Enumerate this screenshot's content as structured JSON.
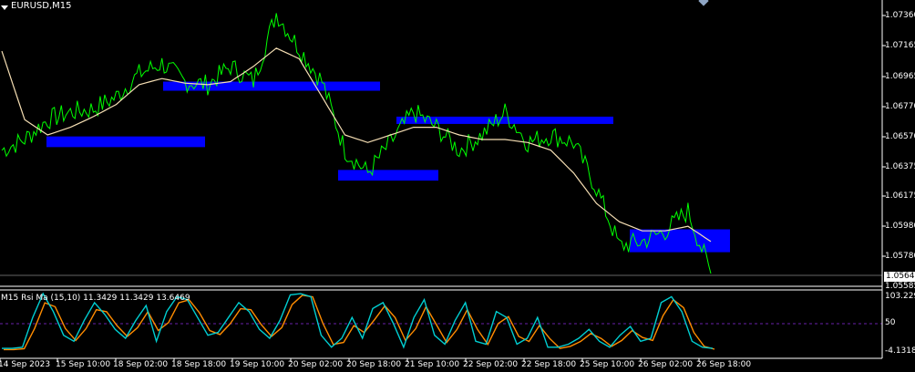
{
  "chart_title": "EURUSD,M15",
  "price_axis": {
    "ticks": [
      "1.07360",
      "1.07165",
      "1.06965",
      "1.06770",
      "1.06570",
      "1.06375",
      "1.06175",
      "1.05980",
      "1.05780",
      "1.05585"
    ],
    "current_price": "1.05647"
  },
  "rsi_panel": {
    "label": "M15  Rsi Ma (15,10) 11.3429 11.3429 13.6469",
    "ticks": [
      "103.229",
      "50",
      "-4.1318"
    ]
  },
  "time_axis": {
    "labels": [
      "14 Sep 2023",
      "15 Sep 10:00",
      "18 Sep 02:00",
      "18 Sep 18:00",
      "19 Sep 10:00",
      "20 Sep 02:00",
      "20 Sep 18:00",
      "21 Sep 10:00",
      "22 Sep 02:00",
      "22 Sep 18:00",
      "25 Sep 10:00",
      "26 Sep 02:00",
      "26 Sep 18:00"
    ]
  },
  "colors": {
    "background": "#000000",
    "price_line": "#00ff00",
    "moving_average": "#f5deb3",
    "zones": "#0000ff",
    "rsi_line": "#00ced1",
    "rsi_ma": "#ff8c00",
    "level_line": "#8a2be2"
  },
  "chart_data": {
    "type": "line",
    "title": "EURUSD,M15",
    "x_time_labels": [
      "14 Sep 2023",
      "15 Sep 10:00",
      "18 Sep 02:00",
      "18 Sep 18:00",
      "19 Sep 10:00",
      "20 Sep 02:00",
      "20 Sep 18:00",
      "21 Sep 10:00",
      "22 Sep 02:00",
      "22 Sep 18:00",
      "25 Sep 10:00",
      "26 Sep 02:00",
      "26 Sep 18:00"
    ],
    "ylim": [
      1.0558,
      1.074
    ],
    "series": [
      {
        "values": [
          1.0645,
          1.0652,
          1.0665,
          1.067,
          1.0672,
          1.068,
          1.0695,
          1.0702,
          1.069,
          1.0688,
          1.07,
          1.069,
          1.0735,
          1.0712,
          1.069,
          1.0645,
          1.063,
          1.065,
          1.067,
          1.066,
          1.0645,
          1.0655,
          1.067,
          1.065,
          1.0655,
          1.065,
          1.062,
          1.0582,
          1.0585,
          1.0592,
          1.0605,
          1.0564
        ]
      },
      {
        "values": [
          1.071,
          1.0665,
          1.0655,
          1.066,
          1.0667,
          1.0675,
          1.0688,
          1.0692,
          1.0689,
          1.0688,
          1.069,
          1.07,
          1.0712,
          1.0705,
          1.068,
          1.0655,
          1.065,
          1.0655,
          1.066,
          1.066,
          1.0655,
          1.0652,
          1.0652,
          1.065,
          1.0645,
          1.063,
          1.061,
          1.0598,
          1.0592,
          1.0592,
          1.0595,
          1.0585
        ]
      }
    ],
    "zones": [
      {
        "from_label": "15 Sep 10:00",
        "to_label": "18 Sep 18:00",
        "low": 1.0647,
        "high": 1.0654
      },
      {
        "from_label": "18 Sep 18:00",
        "to_label": "20 Sep 18:00",
        "low": 1.0684,
        "high": 1.069
      },
      {
        "from_label": "20 Sep 18:00",
        "to_label": "21 Sep 10:00",
        "low": 1.0625,
        "high": 1.0632
      },
      {
        "from_label": "21 Sep 10:00",
        "to_label": "25 Sep 10:00",
        "low": 1.0663,
        "high": 1.0667
      },
      {
        "from_label": "26 Sep 02:00",
        "to_label": "26 Sep 18:00",
        "low": 1.0578,
        "high": 1.0593
      }
    ],
    "rsi_ylim": [
      -4.1318,
      103.229
    ],
    "rsi_values": [
      8,
      8,
      10,
      60,
      100,
      70,
      30,
      20,
      55,
      85,
      65,
      40,
      25,
      55,
      80,
      20,
      70,
      95,
      90,
      60,
      30,
      35,
      60,
      85,
      70,
      40,
      25,
      55,
      98,
      100,
      95,
      30,
      10,
      25,
      60,
      25,
      75,
      85,
      50,
      10,
      60,
      90,
      30,
      15,
      55,
      85,
      20,
      15,
      70,
      60,
      15,
      25,
      60,
      10,
      10,
      15,
      25,
      40,
      20,
      10,
      30,
      45,
      20,
      25,
      85,
      95,
      70,
      20,
      10,
      8
    ]
  }
}
